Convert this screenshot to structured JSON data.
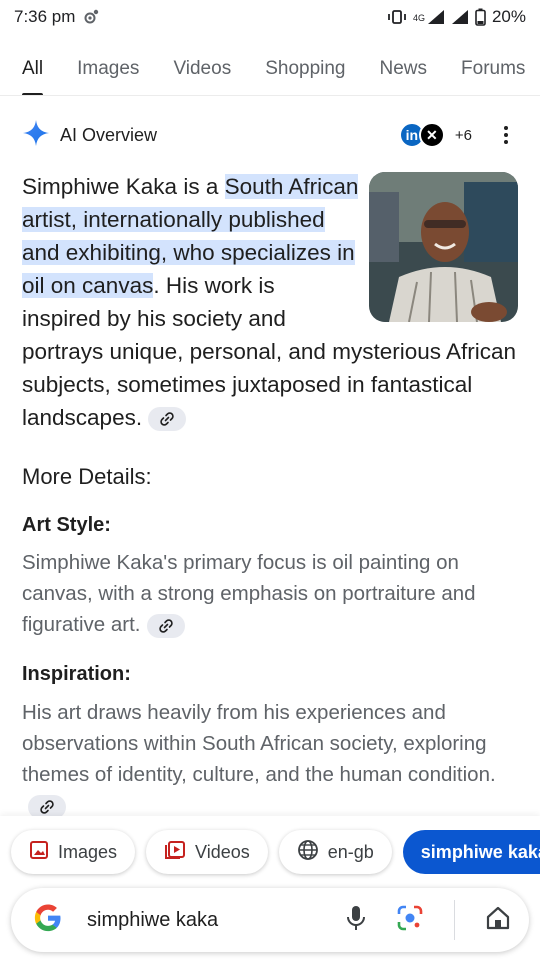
{
  "status_bar": {
    "time": "7:36 pm",
    "network": "4G",
    "battery": "20%"
  },
  "tabs": [
    {
      "label": "All",
      "active": true
    },
    {
      "label": "Images",
      "active": false
    },
    {
      "label": "Videos",
      "active": false
    },
    {
      "label": "Shopping",
      "active": false
    },
    {
      "label": "News",
      "active": false
    },
    {
      "label": "Forums",
      "active": false
    }
  ],
  "ai_overview": {
    "title": "AI Overview",
    "sources_more": "+6",
    "source_icons": [
      "linkedin-icon",
      "x-icon"
    ],
    "intro_plain": "Simphiwe Kaka is a ",
    "intro_highlight": "South African artist, internationally published and exhibiting, who specializes in oil on canvas",
    "intro_rest": ". His work is inspired by his society and portrays unique, personal, and mysterious African subjects, sometimes juxtaposed in fantastical landscapes."
  },
  "more_details": {
    "heading": "More Details:",
    "sections": [
      {
        "title": "Art Style:",
        "text": "Simphiwe Kaka's primary focus is oil painting on canvas, with a strong emphasis on portraiture and figurative art."
      },
      {
        "title": "Inspiration:",
        "text": "His art draws heavily from his experiences and observations within South African society, exploring themes of identity, culture, and the human condition."
      }
    ]
  },
  "chips": {
    "images": "Images",
    "videos": "Videos",
    "language": "en-gb",
    "query": "simphiwe kaka"
  },
  "search": {
    "value": "simphiwe kaka"
  },
  "colors": {
    "accent": "#0b57d0",
    "highlight": "#d3e3fd",
    "secondary_text": "#5f6368"
  }
}
